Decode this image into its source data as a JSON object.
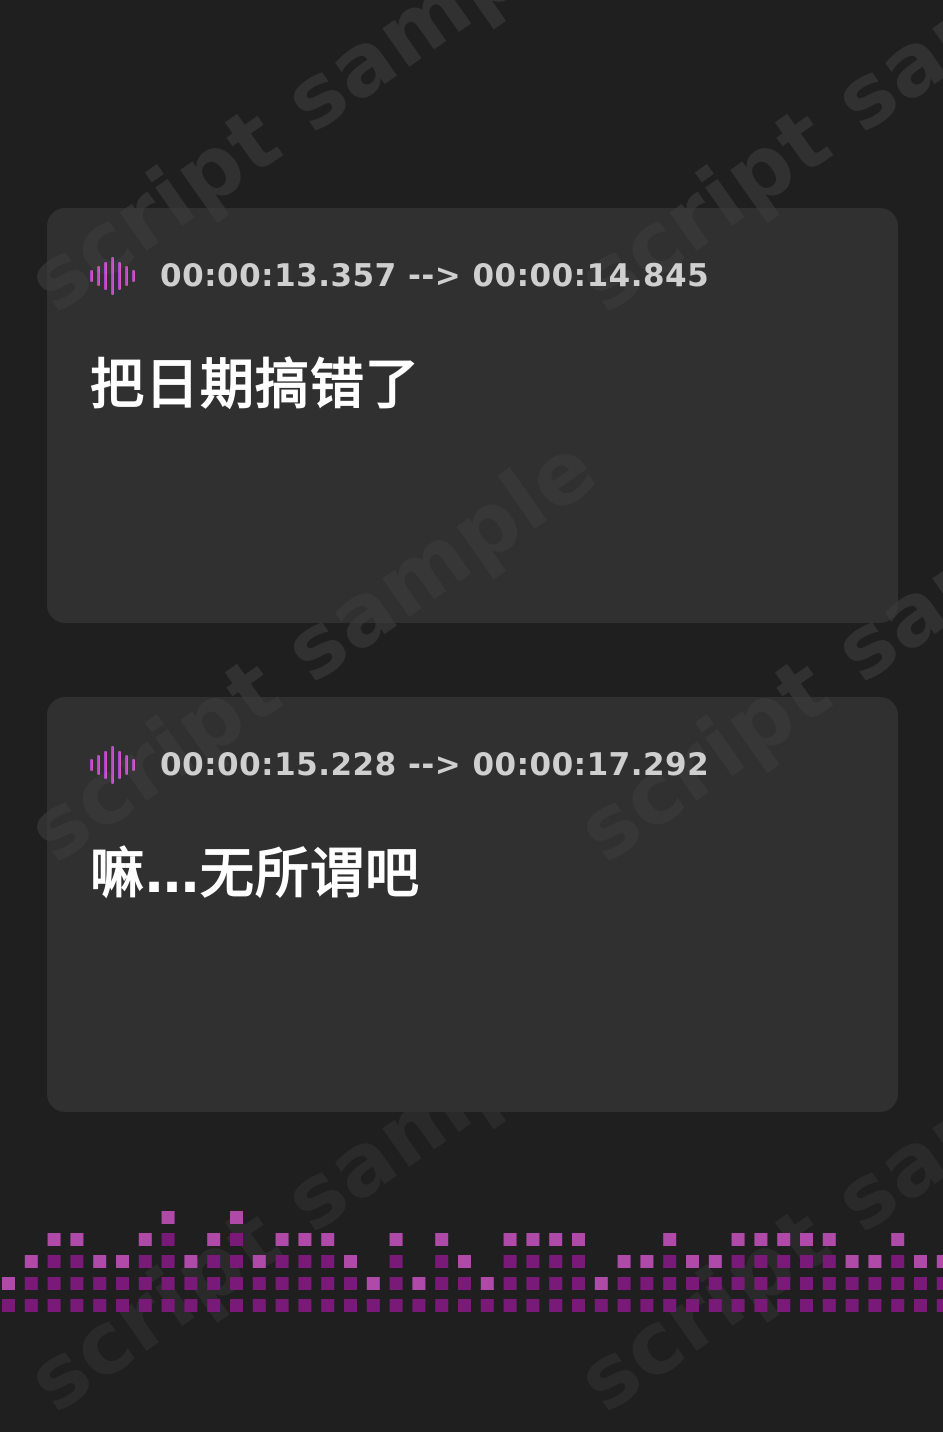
{
  "watermark": {
    "text": "script sample"
  },
  "cues": [
    {
      "timecode": "00:00:13.357 --> 00:00:14.845",
      "text": "把日期搞错了",
      "icon": "sound-wave-icon"
    },
    {
      "timecode": "00:00:15.228 --> 00:00:17.292",
      "text": "嘛…无所谓吧",
      "icon": "sound-wave-icon"
    }
  ],
  "colors": {
    "background": "#1f1f1f",
    "card": "#303030",
    "timecode": "#cfcfcf",
    "text": "#ffffff",
    "accent": "#c040c8",
    "equalizer_dark": "#7a1a78",
    "equalizer_light": "#b04aa8"
  },
  "equalizer": {
    "column_heights": [
      2,
      3,
      4,
      4,
      3,
      3,
      4,
      5,
      3,
      4,
      5,
      3,
      4,
      4,
      4,
      3,
      2,
      4,
      2,
      4,
      3,
      2,
      4,
      4,
      4,
      4,
      2,
      3,
      3,
      4,
      3,
      3,
      4,
      4,
      4,
      4,
      4,
      3,
      3,
      4,
      3,
      3,
      3,
      4,
      3,
      4,
      2,
      3,
      3,
      4,
      3,
      3,
      4,
      3,
      5,
      2,
      5,
      3,
      3,
      2,
      2,
      3,
      3,
      4,
      4
    ]
  }
}
